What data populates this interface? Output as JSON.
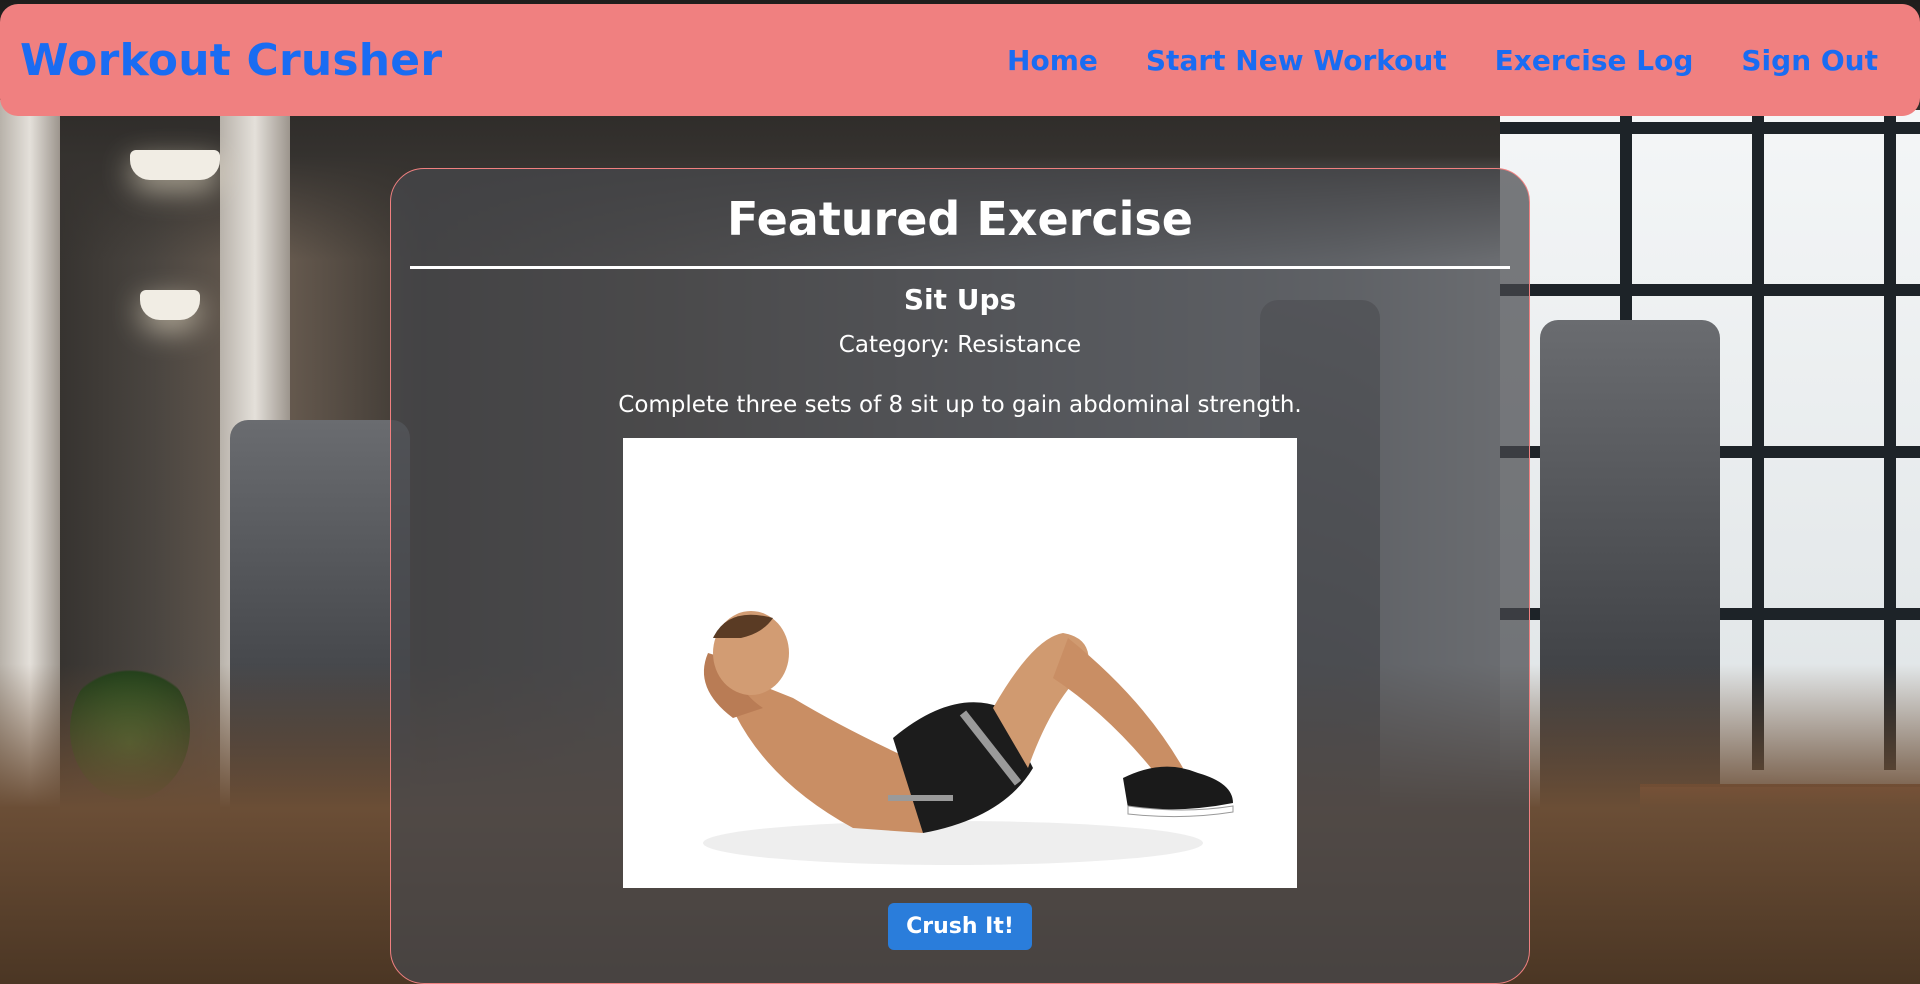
{
  "navbar": {
    "brand": "Workout Crusher",
    "links": [
      {
        "label": "Home"
      },
      {
        "label": "Start New Workout"
      },
      {
        "label": "Exercise Log"
      },
      {
        "label": "Sign Out"
      }
    ],
    "background_color": "#f08080",
    "link_color": "#1a6cf2"
  },
  "featured": {
    "heading": "Featured Exercise",
    "name": "Sit Ups",
    "category": "Category: Resistance",
    "description": "Complete three sets of 8 sit up to gain abdominal strength.",
    "image_icon": "sit-up-photo",
    "button_label": "Crush It!",
    "button_color": "#2a7ddb"
  }
}
